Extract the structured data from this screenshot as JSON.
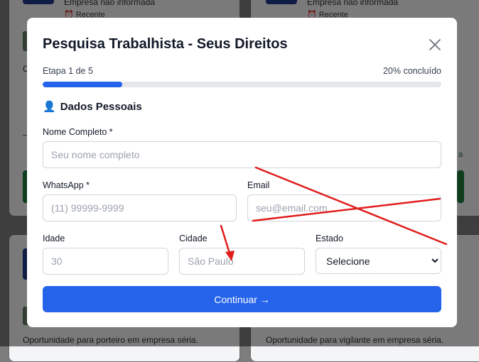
{
  "background": {
    "card_top_left": {
      "company": "Empresa não informada",
      "recent_badge": "⏰ Recente"
    },
    "card_top_right": {
      "company": "Empresa não informada",
      "recent_badge": "⏰ Recente"
    },
    "card_bottom_left": {
      "description": "Oportunidade para porteiro em empresa séria."
    },
    "card_bottom_right": {
      "description": "Oportunidade para vigilante em empresa séria."
    },
    "partial_left_initial": "O",
    "partial_right_letter": "a"
  },
  "modal": {
    "title": "Pesquisa Trabalhista - Seus Direitos",
    "close_icon": "close-icon",
    "step_label": "Etapa 1 de 5",
    "progress_label": "20% concluído",
    "progress_value": 0.2,
    "section": {
      "icon": "👤",
      "title": "Dados Pessoais"
    },
    "fields": {
      "name": {
        "label": "Nome Completo *",
        "placeholder": "Seu nome completo",
        "value": ""
      },
      "whatsapp": {
        "label": "WhatsApp *",
        "placeholder": "(11) 99999-9999",
        "value": ""
      },
      "email": {
        "label": "Email",
        "placeholder": "seu@email.com",
        "value": ""
      },
      "age": {
        "label": "Idade",
        "placeholder": "30",
        "value": ""
      },
      "city": {
        "label": "Cidade",
        "placeholder": "São Paulo",
        "value": ""
      },
      "state": {
        "label": "Estado",
        "selected": "Selecione",
        "options": [
          "Selecione"
        ]
      }
    },
    "submit_label": "Continuar →"
  },
  "colors": {
    "accent": "#2563eb",
    "progress_track": "#e5e7eb",
    "annotation": "#e11d1d"
  }
}
